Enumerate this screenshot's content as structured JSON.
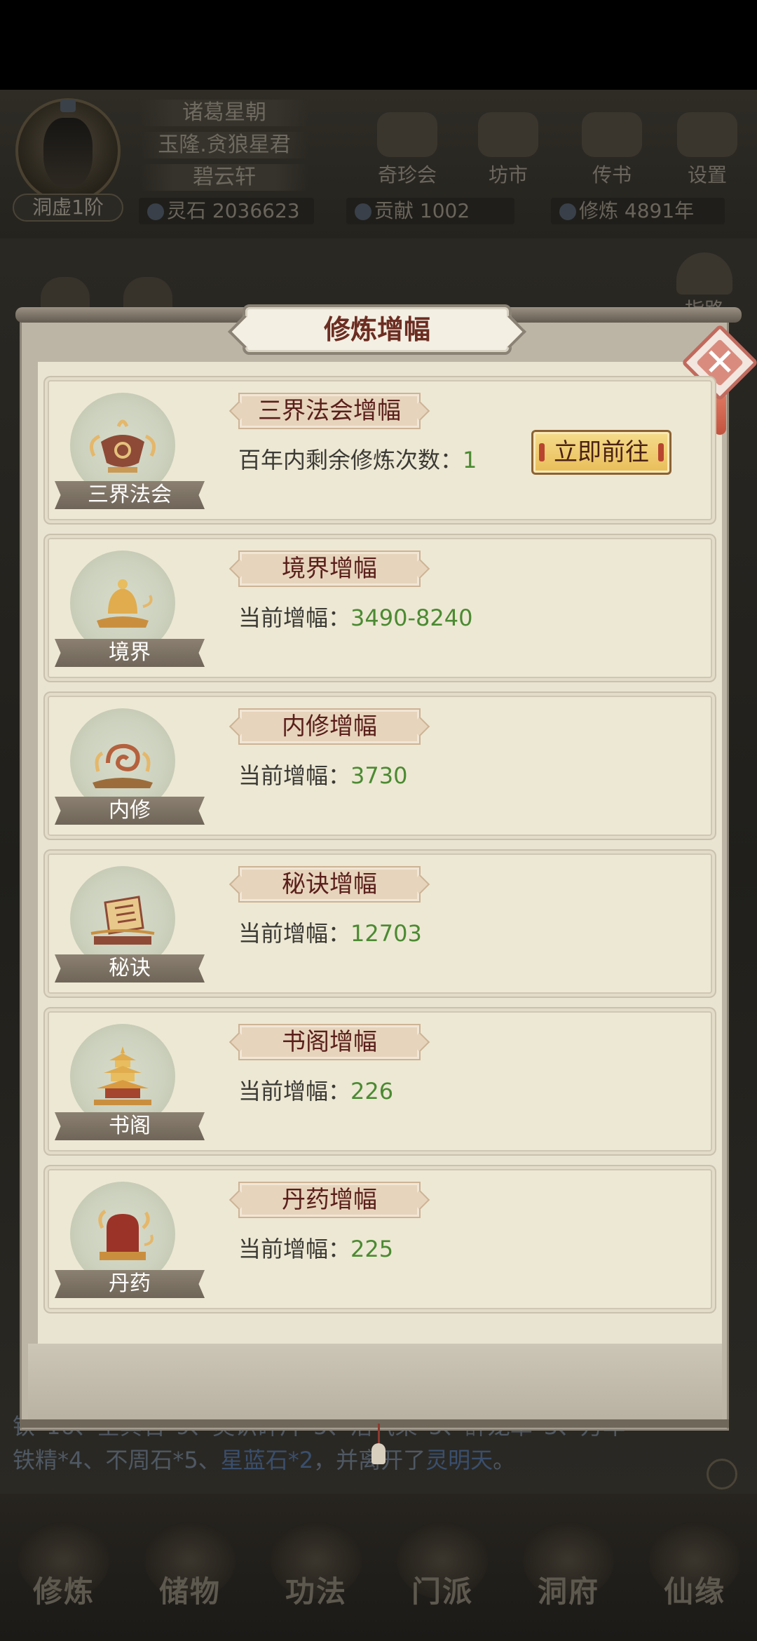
{
  "background": {
    "player": {
      "realm": "洞虚1阶",
      "titles": [
        "诸葛星朝",
        "玉隆.贪狼星君",
        "碧云轩"
      ]
    },
    "menu": [
      "奇珍会",
      "坊市",
      "传书",
      "设置"
    ],
    "resources": [
      {
        "label": "灵石",
        "value": "2036623"
      },
      {
        "label": "贡献",
        "value": "1002"
      },
      {
        "label": "修炼",
        "value": "4891年"
      }
    ],
    "guide": "指路",
    "log_line1": "铁*16、空冥石*9、灵识碎片*5、活气果*5、醉龙草*3、万年",
    "log_line2_a": "铁精*4、不周石*5、",
    "log_line2_b": "星蓝石*2",
    "log_line2_c": "，并离开了",
    "log_line2_d": "灵明天",
    "log_line2_e": "。",
    "bottom_tabs": [
      "修炼",
      "储物",
      "功法",
      "门派",
      "洞府",
      "仙缘"
    ]
  },
  "modal": {
    "title": "修炼增幅",
    "close_label": "✕",
    "entries": [
      {
        "icon_label": "三界法会",
        "title": "三界法会增幅",
        "line_label": "百年内剩余修炼次数：",
        "value": "1",
        "button": "立即前往"
      },
      {
        "icon_label": "境界",
        "title": "境界增幅",
        "line_label": "当前增幅：",
        "value": "3490-8240"
      },
      {
        "icon_label": "内修",
        "title": "内修增幅",
        "line_label": "当前增幅：",
        "value": "3730"
      },
      {
        "icon_label": "秘诀",
        "title": "秘诀增幅",
        "line_label": "当前增幅：",
        "value": "12703"
      },
      {
        "icon_label": "书阁",
        "title": "书阁增幅",
        "line_label": "当前增幅：",
        "value": "226"
      },
      {
        "icon_label": "丹药",
        "title": "丹药增幅",
        "line_label": "当前增幅：",
        "value": "225"
      }
    ]
  },
  "colors": {
    "value_green": "#4b8a32",
    "title_red": "#6c2d22",
    "button_gold": "#e9bd58"
  }
}
